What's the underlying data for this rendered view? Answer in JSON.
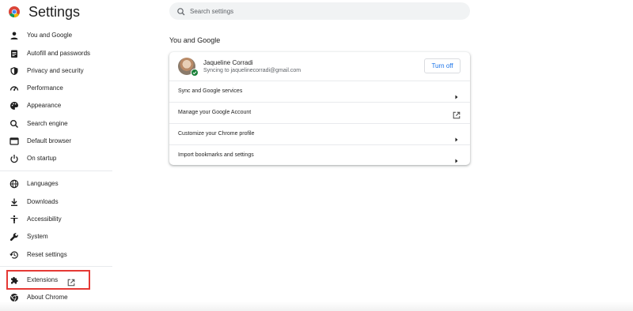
{
  "app": {
    "title": "Settings"
  },
  "search": {
    "placeholder": "Search settings"
  },
  "sidebar": {
    "items": [
      {
        "label": "You and Google",
        "icon": "person-icon"
      },
      {
        "label": "Autofill and passwords",
        "icon": "clipboard-icon"
      },
      {
        "label": "Privacy and security",
        "icon": "shield-icon"
      },
      {
        "label": "Performance",
        "icon": "speedometer-icon"
      },
      {
        "label": "Appearance",
        "icon": "palette-icon"
      },
      {
        "label": "Search engine",
        "icon": "search-icon"
      },
      {
        "label": "Default browser",
        "icon": "browser-icon"
      },
      {
        "label": "On startup",
        "icon": "power-icon"
      },
      {
        "label": "Languages",
        "icon": "globe-icon"
      },
      {
        "label": "Downloads",
        "icon": "download-icon"
      },
      {
        "label": "Accessibility",
        "icon": "accessibility-icon"
      },
      {
        "label": "System",
        "icon": "wrench-icon"
      },
      {
        "label": "Reset settings",
        "icon": "history-icon"
      },
      {
        "label": "Extensions",
        "icon": "puzzle-icon"
      },
      {
        "label": "About Chrome",
        "icon": "chrome-icon"
      }
    ]
  },
  "main": {
    "section_title": "You and Google",
    "profile": {
      "name": "Jaqueline Corradi",
      "sync_status": "Syncing to jaquelinecorradi@gmail.com",
      "turn_off_label": "Turn off"
    },
    "rows": [
      {
        "label": "Sync and Google services",
        "icon": "arrow-right-icon"
      },
      {
        "label": "Manage your Google Account",
        "icon": "external-link-icon"
      },
      {
        "label": "Customize your Chrome profile",
        "icon": "arrow-right-icon"
      },
      {
        "label": "Import bookmarks and settings",
        "icon": "arrow-right-icon"
      }
    ]
  },
  "colors": {
    "accent": "#1a73e8",
    "highlight": "#e53935",
    "sync_badge": "#188038",
    "search_bg": "#f1f3f4"
  }
}
